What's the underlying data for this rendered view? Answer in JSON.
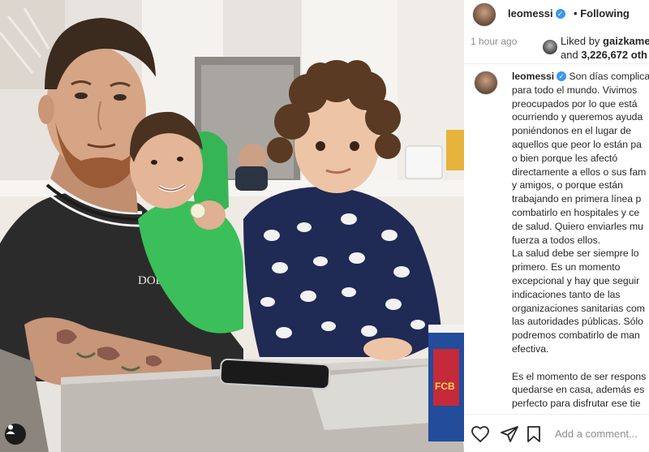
{
  "header": {
    "username": "leomessi",
    "separator": "•",
    "follow_status": "Following"
  },
  "meta": {
    "time_ago": "1 hour ago",
    "liked_prefix": "Liked by ",
    "liked_user": "gaizkame",
    "liked_rest_prefix": "and ",
    "liked_count": "3,226,672 oth"
  },
  "caption": {
    "username": "leomessi",
    "text": " Son días complica\npara todo el mundo. Vivimos\npreocupados por lo que está\nocurriendo y queremos ayuda\nponiéndonos en el lugar de\naquellos que peor lo están pa\no bien porque les afectó\ndirectamente a ellos o sus fam\ny amigos, o porque están\ntrabajando en primera línea p\ncombatirlo en hospitales y ce\nde salud. Quiero enviarles mu\nfuerza a todos ellos.\nLa salud debe ser siempre lo\nprimero. Es un momento\nexcepcional y hay que seguir\nindicaciones tanto de las\norganizaciones sanitarias com\nlas autoridades públicas. Sólo\npodremos combatirlo de man\nefectiva.\n\nEs el momento de ser respons\nquedarse en casa, además es\nperfecto para disfrutar ese tie"
  },
  "composer": {
    "placeholder": "Add a comment..."
  },
  "photo": {
    "shirt_text": "DOLCE & GA",
    "cup_text": "FCB"
  },
  "icons": {
    "verified": "verified-badge-icon",
    "like": "heart-icon",
    "share": "paper-plane-icon",
    "save": "bookmark-icon",
    "profile": "user-icon"
  },
  "colors": {
    "verified_blue": "#3897f0",
    "muted_text": "#8e8e8e",
    "text": "#262626"
  }
}
